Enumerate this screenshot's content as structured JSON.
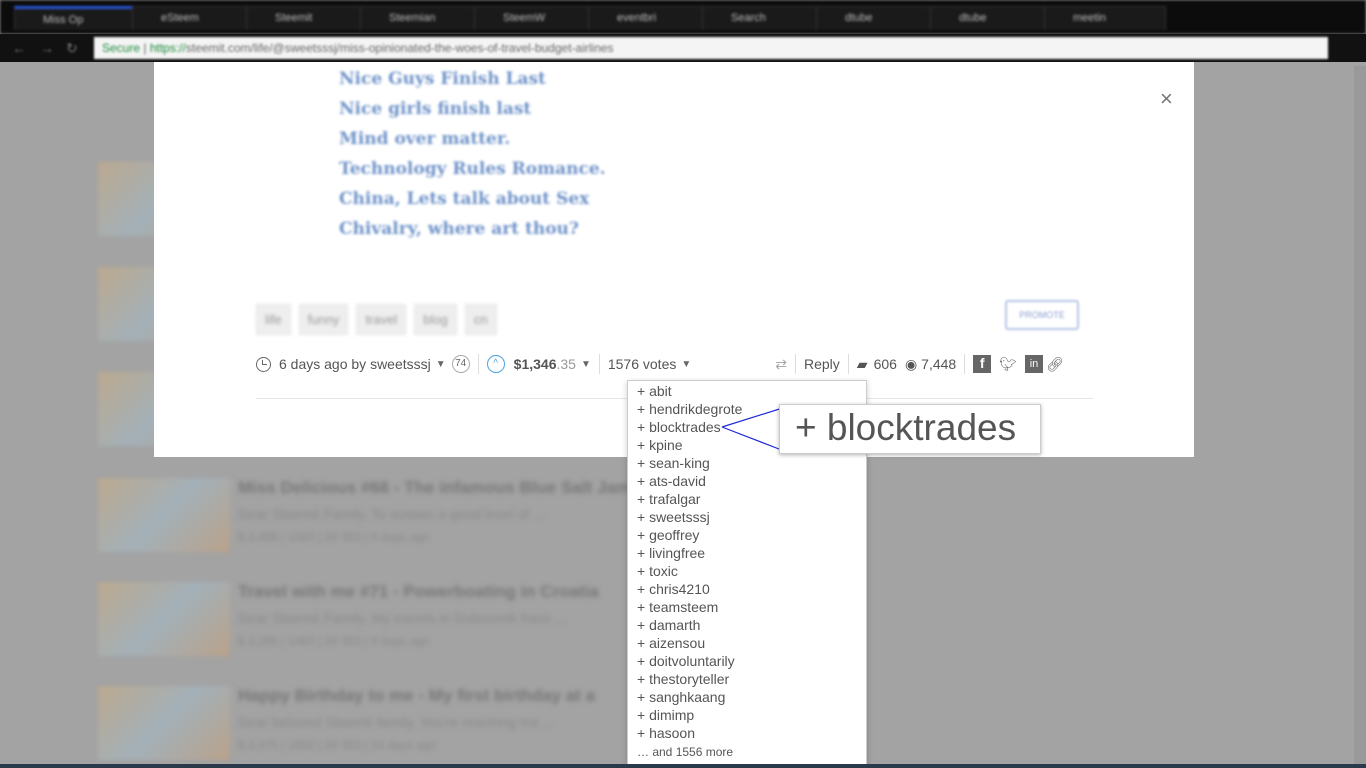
{
  "browser": {
    "tabs": [
      "Miss Op",
      "eSteem",
      "Steemit",
      "Steemian",
      "SteemW",
      "eventbri",
      "Search",
      "dtube",
      "dtube",
      "meetin"
    ],
    "secure_label": "Secure",
    "url_scheme": "https://",
    "url_rest": "steemit.com/life/@sweetsssj/miss-opinionated-the-woes-of-travel-budget-airlines"
  },
  "background_posts": [
    {
      "title": "Miss Delicious #66 - The infamous Blue Salt Jam",
      "excerpt": "Dear Steemit Family, To sustain a good level of ...",
      "meta": "$ 4,488  |  1583  |  28 363  |  6 days ago"
    },
    {
      "title": "Travel with me #71 - Powerboating in Croatia",
      "excerpt": "Dear Steemit Family, My travels in Dubrovnik have ...",
      "meta": "$ 3,266  |  1483  |  28 363  |  9 days ago"
    },
    {
      "title": "Happy Birthday to me - My first birthday at a",
      "excerpt": "Dear beloved Steemit family, You're reaching me ...",
      "meta": "$ 4,475  |  1650  |  28 363  |  14 days ago"
    }
  ],
  "modal": {
    "close_label": "×",
    "poem_lines": [
      "Nice Guys Finish Last",
      "Nice girls finish last",
      "Mind over matter.",
      "Technology Rules Romance.",
      "China, Lets talk about Sex",
      "Chivalry, where art thou?"
    ],
    "tags": [
      "life",
      "funny",
      "travel",
      "blog",
      "cn"
    ],
    "promote_label": "PROMOTE",
    "meta": {
      "time": "6 days ago by",
      "author": "sweetsssj",
      "reputation": "74",
      "payout_main": "$1,346",
      "payout_cents": ".35",
      "votes": "1576 votes",
      "reply": "Reply",
      "comments": "606",
      "views": "7,448"
    }
  },
  "voters": [
    "+ abit",
    "+ hendrikdegrote",
    "+ blocktrades",
    "+ kpine",
    "+ sean-king",
    "+ ats-david",
    "+ trafalgar",
    "+ sweetsssj",
    "+ geoffrey",
    "+ livingfree",
    "+ toxic",
    "+ chris4210",
    "+ teamsteem",
    "+ damarth",
    "+ aizensou",
    "+ doitvoluntarily",
    "+ thestoryteller",
    "+ sanghkaang",
    "+ dimimp",
    "+ hasoon"
  ],
  "voters_more": "… and 1556 more",
  "magnifier_text": "+ blocktrades",
  "colors": {
    "accent": "#4aa3df",
    "callout_line": "#1f2bd8",
    "overlay": "#a3a3a3"
  }
}
